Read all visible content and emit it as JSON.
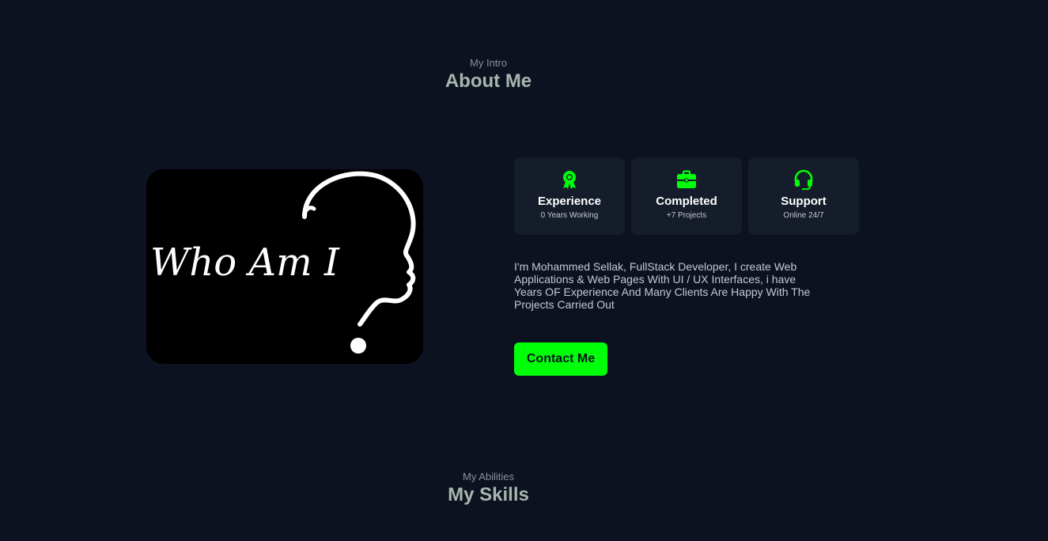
{
  "about": {
    "subtitle": "My Intro",
    "title": "About Me",
    "image_text": "Who Am I",
    "cards": [
      {
        "icon": "award-icon",
        "title": "Experience",
        "sub": "0 Years Working"
      },
      {
        "icon": "briefcase-icon",
        "title": "Completed",
        "sub": "+7 Projects"
      },
      {
        "icon": "headset-icon",
        "title": "Support",
        "sub": "Online 24/7"
      }
    ],
    "description": "I'm Mohammed Sellak, FullStack Developer, I create Web Applications & Web Pages With UI / UX Interfaces, i have Years OF Experience And Many Clients Are Happy With The Projects Carried Out",
    "contact_label": "Contact Me"
  },
  "skills": {
    "subtitle": "My Abilities",
    "title": "My Skills"
  },
  "colors": {
    "background": "#0c1220",
    "card": "#161d2a",
    "accent": "#00ff08",
    "heading": "#a9b6ad"
  }
}
